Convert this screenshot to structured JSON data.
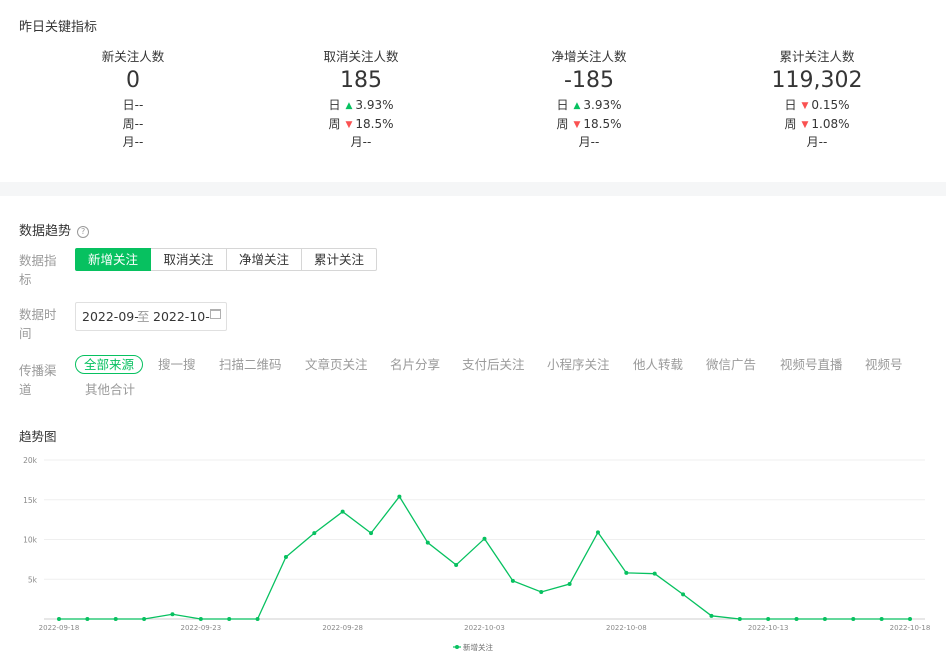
{
  "summary": {
    "title": "昨日关键指标",
    "cards": [
      {
        "label": "新关注人数",
        "value": "0",
        "day": "日--",
        "week": "周--",
        "month": "月--"
      },
      {
        "label": "取消关注人数",
        "value": "185",
        "day_prefix": "日",
        "day_dir": "up",
        "day_val": "3.93%",
        "week_prefix": "周",
        "week_dir": "down",
        "week_val": "18.5%",
        "month": "月--"
      },
      {
        "label": "净增关注人数",
        "value": "-185",
        "day_prefix": "日",
        "day_dir": "up",
        "day_val": "3.93%",
        "week_prefix": "周",
        "week_dir": "down",
        "week_val": "18.5%",
        "month": "月--"
      },
      {
        "label": "累计关注人数",
        "value": "119,302",
        "day_prefix": "日",
        "day_dir": "down",
        "day_val": "0.15%",
        "week_prefix": "周",
        "week_dir": "down",
        "week_val": "1.08%",
        "month": "月--"
      }
    ]
  },
  "trend": {
    "title": "数据趋势",
    "help_icon": "question-circle-icon",
    "metric_label": "数据指标",
    "metrics": [
      "新增关注",
      "取消关注",
      "净增关注",
      "累计关注"
    ],
    "active_metric": 0,
    "time_label": "数据时间",
    "date_start": "2022-09-",
    "date_sep": "至",
    "date_end": "2022-10-",
    "calendar_icon": "calendar-icon",
    "channel_label": "传播渠道",
    "channels": [
      "全部来源",
      "搜一搜",
      "扫描二维码",
      "文章页关注",
      "名片分享",
      "支付后关注",
      "小程序关注",
      "他人转载",
      "微信广告",
      "视频号直播",
      "视频号",
      "其他合计"
    ],
    "active_channel": 0
  },
  "chart_title": "趋势图",
  "colors": {
    "accent": "#07c160",
    "up": "#07c160",
    "down": "#fa5151"
  },
  "chart_data": {
    "type": "line",
    "x": [
      "2022-09-18",
      "2022-09-19",
      "2022-09-20",
      "2022-09-21",
      "2022-09-22",
      "2022-09-23",
      "2022-09-24",
      "2022-09-25",
      "2022-09-26",
      "2022-09-27",
      "2022-09-28",
      "2022-09-29",
      "2022-09-30",
      "2022-10-01",
      "2022-10-02",
      "2022-10-03",
      "2022-10-04",
      "2022-10-05",
      "2022-10-06",
      "2022-10-07",
      "2022-10-08",
      "2022-10-09",
      "2022-10-10",
      "2022-10-11",
      "2022-10-12",
      "2022-10-13",
      "2022-10-14",
      "2022-10-15",
      "2022-10-16",
      "2022-10-17",
      "2022-10-18"
    ],
    "x_tick_labels": [
      "2022-09-18",
      "2022-09-23",
      "2022-09-28",
      "2022-10-03",
      "2022-10-08",
      "2022-10-13",
      "2022-10-18"
    ],
    "x_tick_indices": [
      0,
      5,
      10,
      15,
      20,
      25,
      30
    ],
    "series": [
      {
        "name": "新增关注",
        "color": "#07c160",
        "values": [
          0,
          0,
          0,
          0,
          600,
          0,
          0,
          0,
          7800,
          10800,
          13500,
          10800,
          15400,
          9600,
          6800,
          10100,
          4800,
          3400,
          4400,
          10900,
          5800,
          5700,
          3100,
          400,
          0,
          0,
          0,
          0,
          0,
          0,
          0
        ]
      }
    ],
    "ylim": [
      0,
      20000
    ],
    "y_ticks": [
      5000,
      10000,
      15000,
      20000
    ],
    "y_tick_labels": [
      "5k",
      "10k",
      "15k",
      "20k"
    ],
    "legend": "bottom-center",
    "grid": true
  }
}
